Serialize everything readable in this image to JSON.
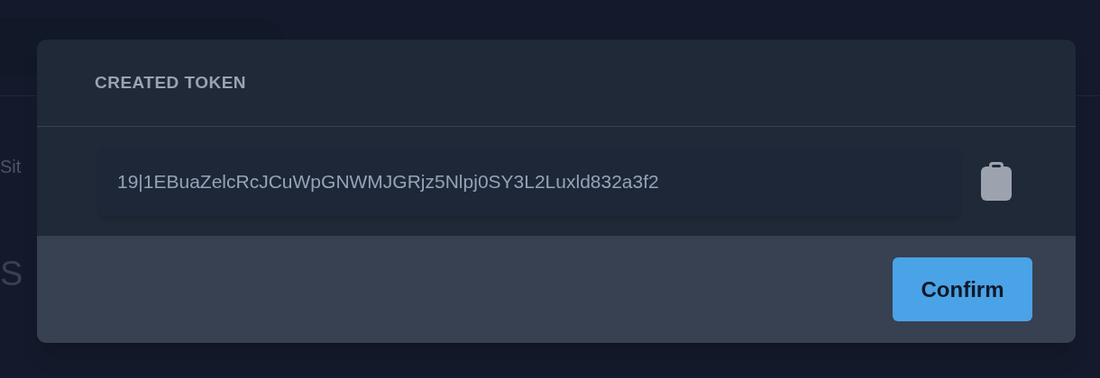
{
  "background": {
    "label": "Sit",
    "heading": "S"
  },
  "modal": {
    "title": "CREATED TOKEN",
    "token": "19|1EBuaZelcRcJCuWpGNWMJGRjz5Nlpj0SY3L2Luxld832a3f2",
    "confirm": "Confirm"
  }
}
